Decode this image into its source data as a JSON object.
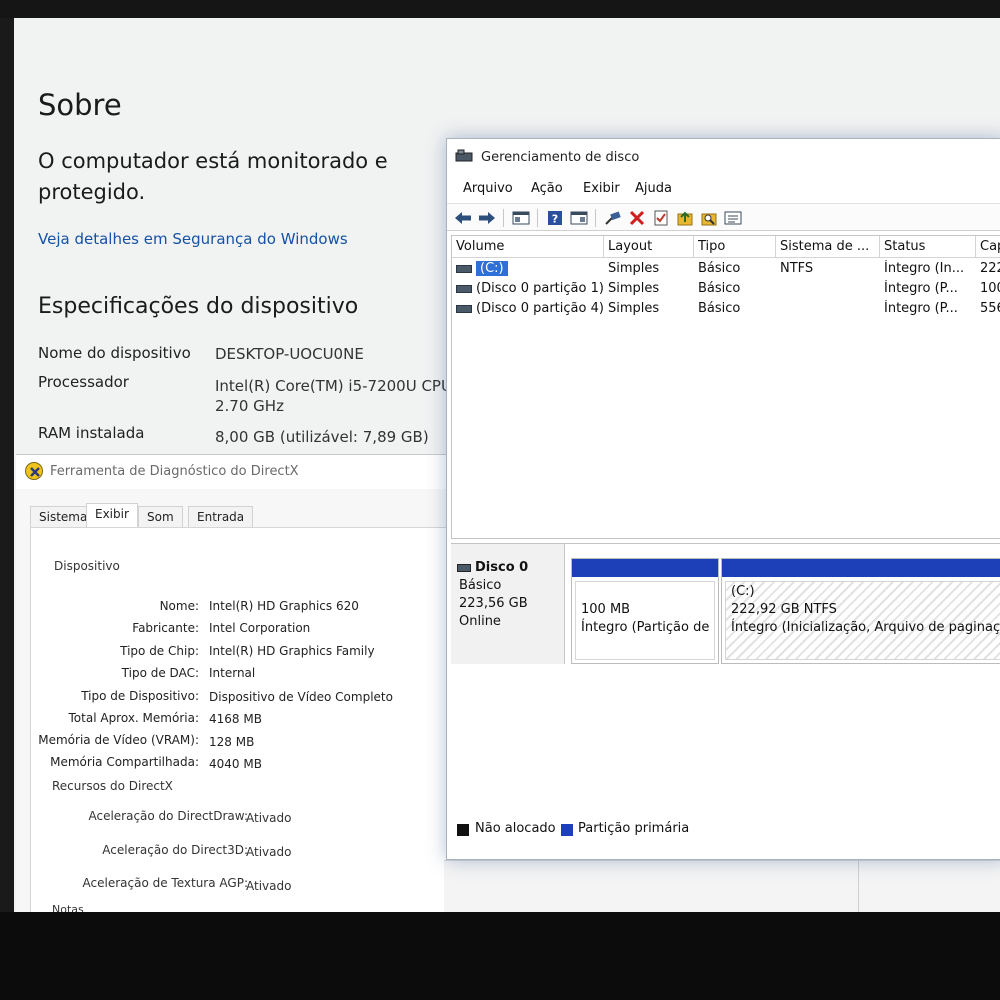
{
  "settings": {
    "title": "Sobre",
    "protected_text": "O computador está monitorado e protegido.",
    "security_link": "Veja detalhes em Segurança do Windows",
    "specs_title": "Especificações do dispositivo",
    "specs": [
      {
        "label": "Nome do dispositivo",
        "value": "DESKTOP-UOCU0NE"
      },
      {
        "label": "Processador",
        "value": "Intel(R) Core(TM) i5-7200U CPU",
        "value2": "2.70 GHz"
      },
      {
        "label": "RAM instalada",
        "value": "8,00 GB (utilizável: 7,89 GB)"
      }
    ]
  },
  "dxdiag": {
    "title": "Ferramenta de Diagnóstico do DirectX",
    "tabs": [
      "Sistema",
      "Exibir",
      "Som",
      "Entrada"
    ],
    "device_group": "Dispositivo",
    "device": [
      {
        "label": "Nome:",
        "value": "Intel(R) HD Graphics 620"
      },
      {
        "label": "Fabricante:",
        "value": "Intel Corporation"
      },
      {
        "label": "Tipo de Chip:",
        "value": "Intel(R) HD Graphics Family"
      },
      {
        "label": "Tipo de DAC:",
        "value": "Internal"
      },
      {
        "label": "Tipo de Dispositivo:",
        "value": "Dispositivo de Vídeo Completo"
      },
      {
        "label": "Total Aprox. Memória:",
        "value": "4168 MB"
      },
      {
        "label": "Memória de Vídeo (VRAM):",
        "value": "128 MB"
      },
      {
        "label": "Memória Compartilhada:",
        "value": "4040 MB"
      }
    ],
    "resources_group": "Recursos do DirectX",
    "resources": [
      {
        "label": "Aceleração do DirectDraw:",
        "value": "Ativado"
      },
      {
        "label": "Aceleração do Direct3D:",
        "value": "Ativado"
      },
      {
        "label": "Aceleração de Textura AGP:",
        "value": "Ativado"
      }
    ],
    "notes_label": "Notas"
  },
  "diskmgmt": {
    "title": "Gerenciamento de disco",
    "menu": [
      "Arquivo",
      "Ação",
      "Exibir",
      "Ajuda"
    ],
    "toolbar_icons": [
      "back-arrow-icon",
      "forward-arrow-icon",
      "console-icon",
      "help-icon",
      "properties-icon",
      "connect-icon",
      "delete-icon",
      "check-icon",
      "folder-up-icon",
      "search-folder-icon",
      "list-icon"
    ],
    "columns": [
      "Volume",
      "Layout",
      "Tipo",
      "Sistema de ...",
      "Status",
      "Cap"
    ],
    "rows": [
      {
        "volume": "(C:)",
        "layout": "Simples",
        "tipo": "Básico",
        "fs": "NTFS",
        "status": "Íntegro (In...",
        "cap": "222"
      },
      {
        "volume": "(Disco 0 partição 1)",
        "layout": "Simples",
        "tipo": "Básico",
        "fs": "",
        "status": "Íntegro (P...",
        "cap": "100"
      },
      {
        "volume": "(Disco 0 partição 4)",
        "layout": "Simples",
        "tipo": "Básico",
        "fs": "",
        "status": "Íntegro (P...",
        "cap": "556"
      }
    ],
    "disk": {
      "name": "Disco 0",
      "type": "Básico",
      "size": "223,56 GB",
      "state": "Online"
    },
    "partitions": [
      {
        "label": "",
        "size": "100 MB",
        "status": "Íntegro (Partição de S"
      },
      {
        "label": "(C:)",
        "size": "222,92 GB NTFS",
        "status": "Íntegro (Inicialização, Arquivo de paginaçã"
      }
    ],
    "legend": [
      {
        "label": "Não alocado",
        "color": "#111111"
      },
      {
        "label": "Partição primária",
        "color": "#1d3fb8"
      }
    ]
  }
}
